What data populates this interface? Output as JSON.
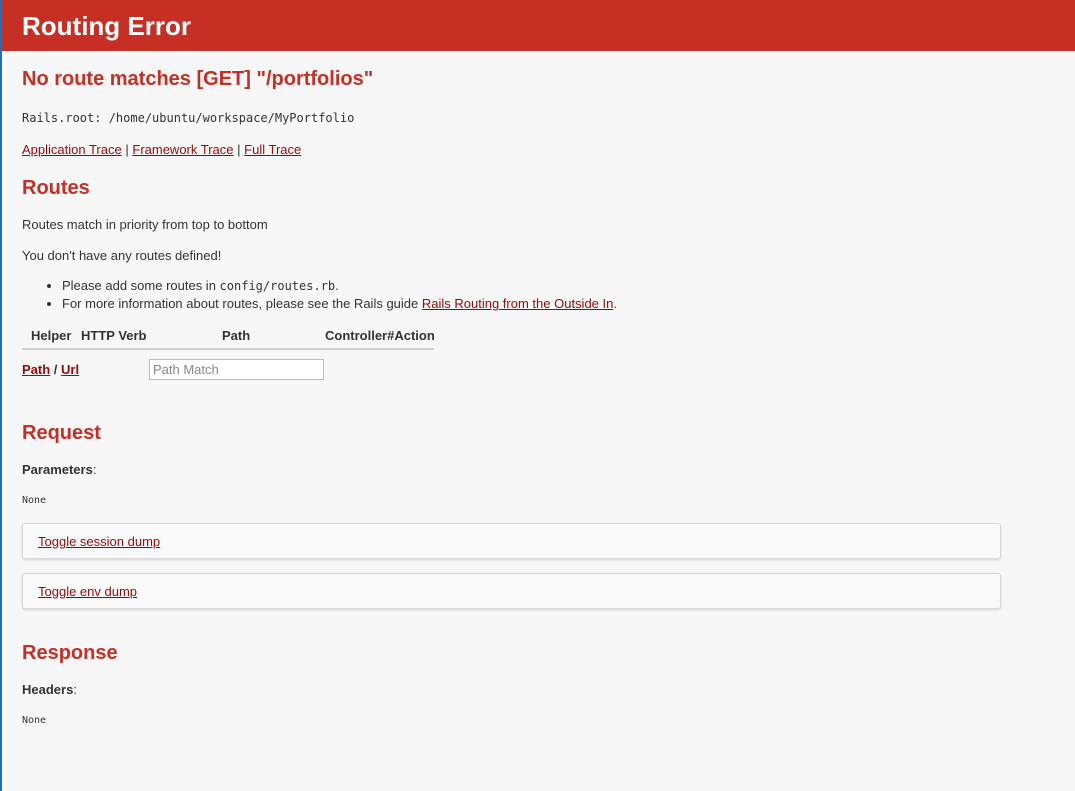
{
  "header": {
    "title": "Routing Error"
  },
  "error": {
    "message": "No route matches [GET] \"/portfolios\"",
    "rails_root": "Rails.root: /home/ubuntu/workspace/MyPortfolio"
  },
  "traces": {
    "application": "Application Trace",
    "framework": "Framework Trace",
    "full": "Full Trace",
    "separator": "|"
  },
  "routes": {
    "heading": "Routes",
    "priority_text": "Routes match in priority from top to bottom",
    "none_defined": "You don't have any routes defined!",
    "bullet1_prefix": "Please add some routes in ",
    "bullet1_code": "config/routes.rb",
    "bullet1_suffix": ".",
    "bullet2_prefix": "For more information about routes, please see the Rails guide ",
    "bullet2_link": "Rails Routing from the Outside In",
    "bullet2_suffix": ".",
    "columns": [
      "Helper",
      "HTTP Verb",
      "Path",
      "Controller#Action"
    ],
    "path_link": "Path",
    "url_link": "Url",
    "slash": "/",
    "search_placeholder": "Path Match"
  },
  "request": {
    "heading": "Request",
    "parameters_label": "Parameters",
    "colon": ":",
    "parameters_value": "None",
    "toggle_session": "Toggle session dump",
    "toggle_env": "Toggle env dump"
  },
  "response": {
    "heading": "Response",
    "headers_label": "Headers",
    "colon": ":",
    "headers_value": "None"
  },
  "colors": {
    "brand_red": "#c52f24",
    "link": "#980905",
    "background": "#f7f7f7"
  }
}
